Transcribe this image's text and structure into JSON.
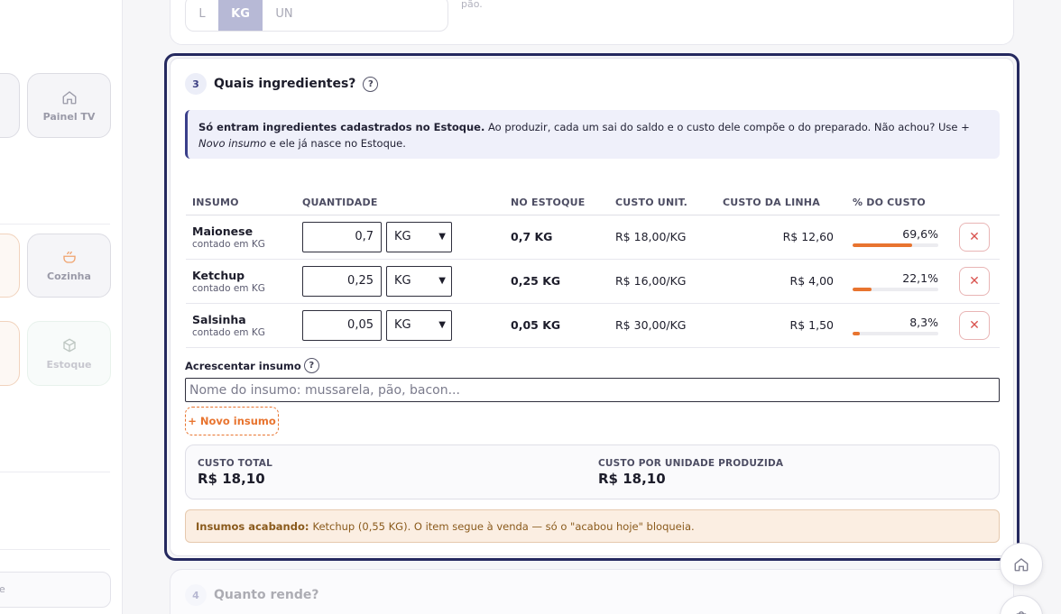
{
  "sidebar": {
    "tiles": [
      {
        "label": "Painel TV",
        "icon": "home-icon"
      },
      {
        "label": "Cozinha",
        "icon": "cooking-pot-icon"
      },
      {
        "label": "Estoque",
        "icon": "box-icon"
      }
    ],
    "bottom_text": "e"
  },
  "unit_selector": {
    "options": [
      "L",
      "KG",
      "UN"
    ],
    "selected": "KG",
    "hint": "L: molho, caldo · KG: massa, recheio · UN: bolinho, pão."
  },
  "step3": {
    "number": "3",
    "title": "Quais ingredientes?",
    "help": "?",
    "info_bold": "Só entram ingredientes cadastrados no Estoque.",
    "info_text": " Ao produzir, cada um sai do saldo e o custo dele compõe o do preparado. Não achou? Use ",
    "info_italic": "+ Novo insumo",
    "info_tail": " e ele já nasce no Estoque."
  },
  "table": {
    "headers": [
      "INSUMO",
      "QUANTIDADE",
      "NO ESTOQUE",
      "CUSTO UNIT.",
      "CUSTO DA LINHA",
      "% DO CUSTO"
    ],
    "rows": [
      {
        "name": "Maionese",
        "sub": "contado em KG",
        "qty": "0,7",
        "unit": "KG",
        "stock": "0,7 KG",
        "unit_cost": "R$ 18,00/KG",
        "line_cost": "R$ 12,60",
        "pct": "69,6%",
        "pct_value": 69.6
      },
      {
        "name": "Ketchup",
        "sub": "contado em KG",
        "qty": "0,25",
        "unit": "KG",
        "stock": "0,25 KG",
        "unit_cost": "R$ 16,00/KG",
        "line_cost": "R$ 4,00",
        "pct": "22,1%",
        "pct_value": 22.1
      },
      {
        "name": "Salsinha",
        "sub": "contado em KG",
        "qty": "0,05",
        "unit": "KG",
        "stock": "0,05 KG",
        "unit_cost": "R$ 30,00/KG",
        "line_cost": "R$ 1,50",
        "pct": "8,3%",
        "pct_value": 8.3
      }
    ],
    "remove_icon": "close-icon"
  },
  "add": {
    "label": "Acrescentar insumo",
    "placeholder": "Nome do insumo: mussarela, pão, bacon...",
    "new_button": "+ Novo insumo"
  },
  "totals": {
    "total_label": "CUSTO TOTAL",
    "total_value": "R$ 18,10",
    "per_unit_label": "CUSTO POR UNIDADE PRODUZIDA",
    "per_unit_value": "R$ 18,10"
  },
  "warning": {
    "bold": "Insumos acabando:",
    "text": "Ketchup (0,55 KG). O item segue à venda — só o \"acabou hoje\" bloqueia."
  },
  "step4": {
    "number": "4",
    "title": "Quanto rende?"
  },
  "colors": {
    "accent": "#25295f",
    "orange": "#e8742f",
    "danger": "#d9534f"
  }
}
